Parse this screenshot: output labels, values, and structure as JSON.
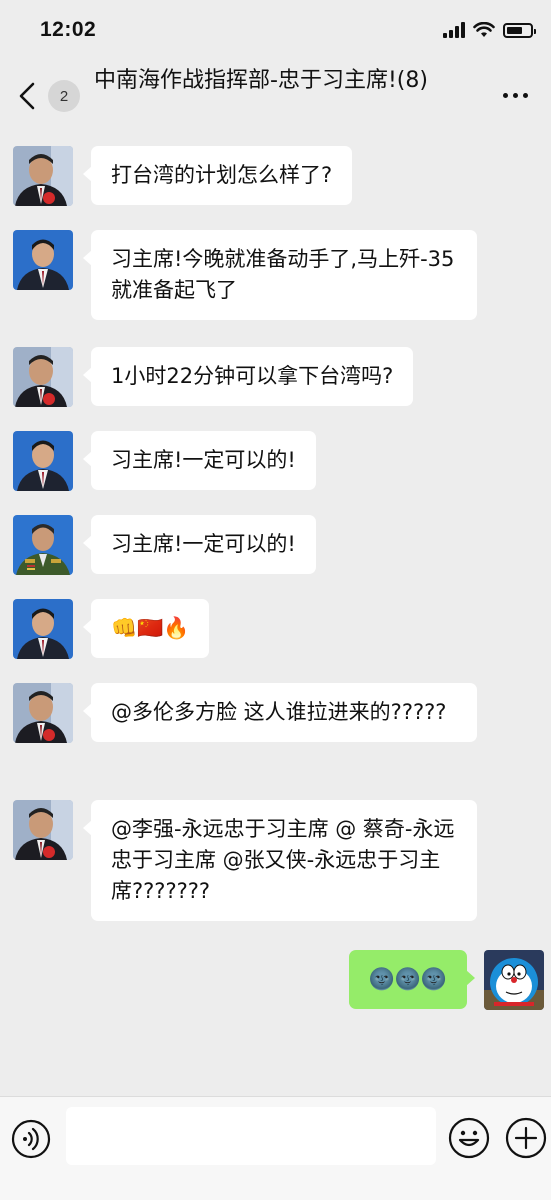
{
  "status": {
    "time": "12:02",
    "battery_level": 0.7
  },
  "header": {
    "unread_count": "2",
    "title": "中南海作战指挥部-忠于习主席!(8)"
  },
  "messages": [
    {
      "side": "left",
      "avatar": "older-man-portrait",
      "text": "打台湾的计划怎么样了?"
    },
    {
      "side": "left",
      "avatar": "man-suit-portrait",
      "text": "习主席!今晚就准备动手了,马上歼-35就准备起飞了"
    },
    {
      "side": "left",
      "avatar": "older-man-portrait",
      "text": "1小时22分钟可以拿下台湾吗?"
    },
    {
      "side": "left",
      "avatar": "man-suit-portrait",
      "text": "习主席!一定可以的!"
    },
    {
      "side": "left",
      "avatar": "military-officer-portrait",
      "text": "习主席!一定可以的!"
    },
    {
      "side": "left",
      "avatar": "man-suit-portrait",
      "text": "👊🇨🇳🔥"
    },
    {
      "side": "left",
      "avatar": "older-man-portrait",
      "text": "@多伦多方脸 这人谁拉进来的?????"
    },
    {
      "side": "left",
      "avatar": "older-man-portrait",
      "text": "@李强-永远忠于习主席 @ 蔡奇-永远忠于习主席 @张又侠-永远忠于习主席???????"
    },
    {
      "side": "right",
      "avatar": "doraemon-avatar",
      "text": "🌚🌚🌚"
    }
  ],
  "input": {
    "placeholder": ""
  },
  "colors": {
    "background": "#ededed",
    "bubble_mine": "#95ec69",
    "bubble_other": "#ffffff"
  }
}
